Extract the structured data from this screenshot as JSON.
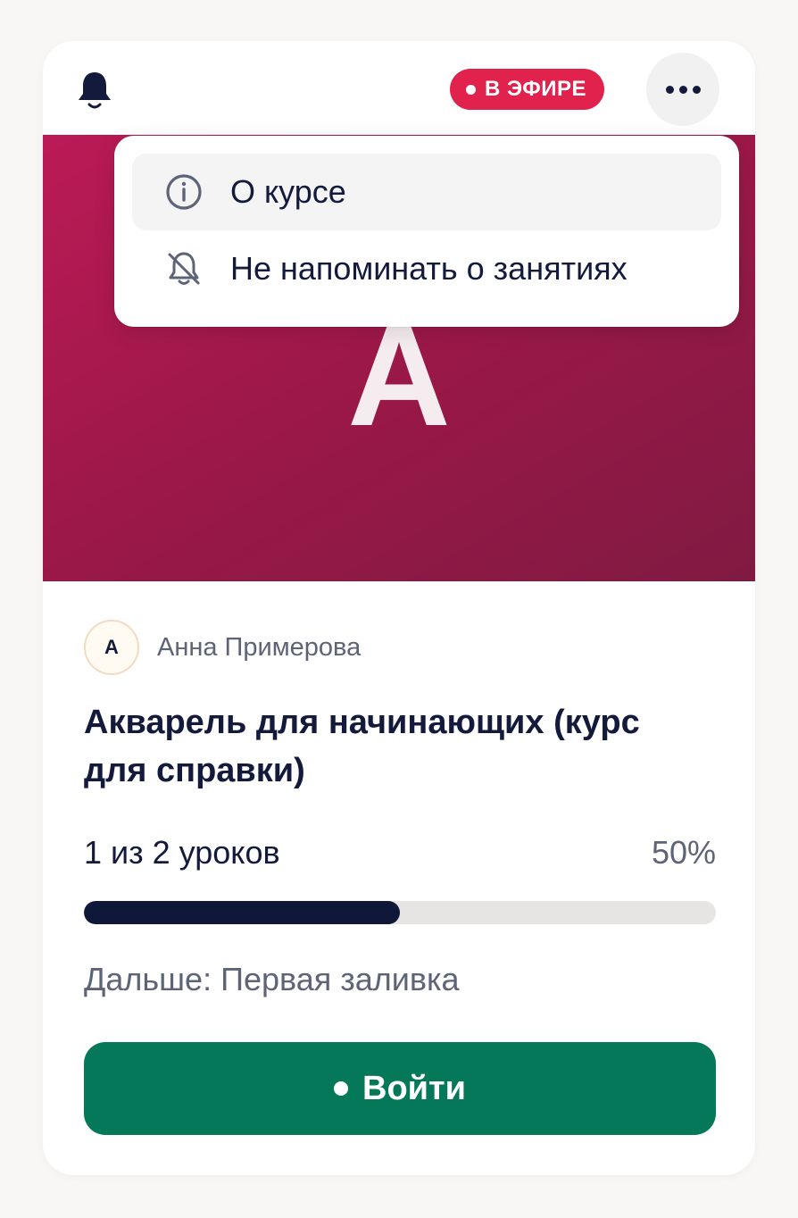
{
  "header": {
    "bell_icon": "bell-icon",
    "live_badge": "В ЭФИРЕ",
    "more_icon": "more-horizontal-icon"
  },
  "cover": {
    "letter": "A"
  },
  "menu": {
    "items": [
      {
        "label": "О курсе",
        "icon": "info-icon"
      },
      {
        "label": "Не напоминать о занятиях",
        "icon": "bell-off-icon"
      }
    ]
  },
  "course": {
    "author_initial": "А",
    "author_name": "Анна Примерова",
    "title": "Акварель для начинающих (курс для справки)",
    "progress_text": "1 из 2 уроков",
    "progress_percent_label": "50%",
    "progress_fraction": 0.5,
    "next_lesson": "Дальше: Первая заливка",
    "enter_button": "Войти"
  },
  "colors": {
    "live": "#e0224c",
    "cover_start": "#bb1a56",
    "cover_end": "#801a42",
    "enter_button": "#06785a",
    "progress_fill": "#0f1838"
  }
}
